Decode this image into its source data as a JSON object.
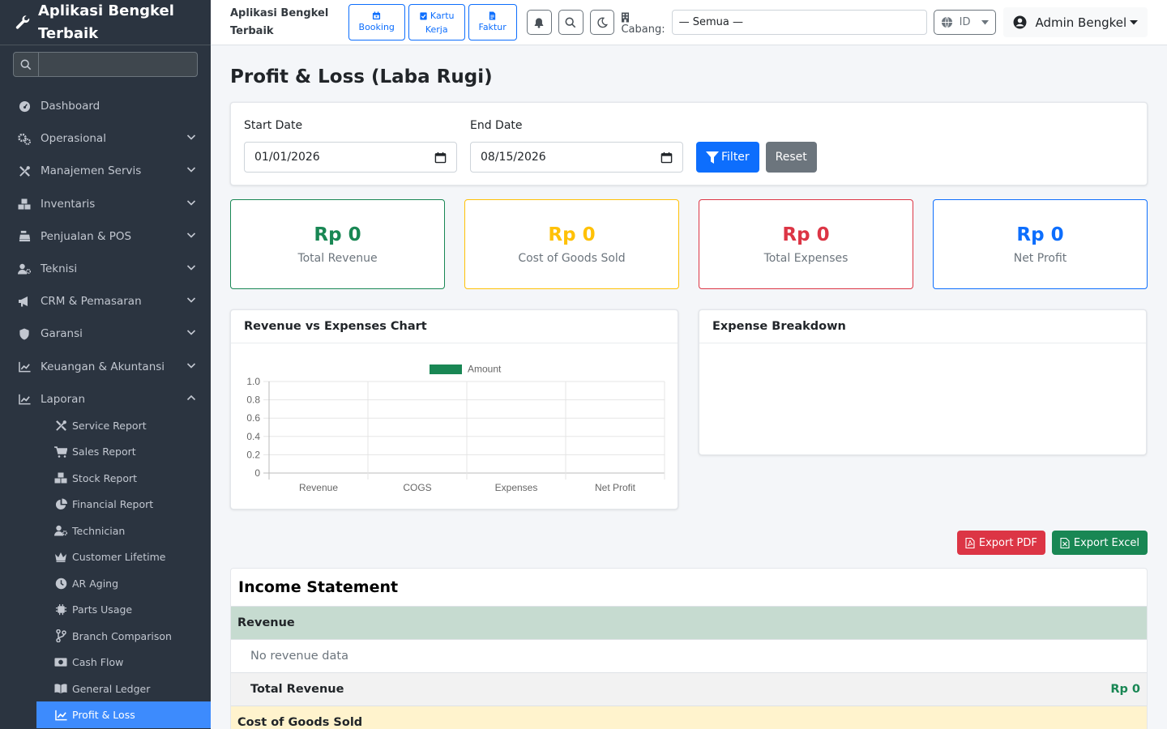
{
  "app": {
    "brand": "Aplikasi Bengkel Terbaik",
    "brand_line1": "Aplikasi Bengkel",
    "brand_line2": "Terbaik"
  },
  "sidebar": {
    "search_placeholder": "",
    "items": [
      {
        "label": "Dashboard",
        "icon": "gauge-icon",
        "has_children": false
      },
      {
        "label": "Operasional",
        "icon": "cogs-icon",
        "has_children": true
      },
      {
        "label": "Manajemen Servis",
        "icon": "tools-icon",
        "has_children": true
      },
      {
        "label": "Inventaris",
        "icon": "boxes-icon",
        "has_children": true
      },
      {
        "label": "Penjualan & POS",
        "icon": "cash-register-icon",
        "has_children": true
      },
      {
        "label": "Teknisi",
        "icon": "user-gear-icon",
        "has_children": true
      },
      {
        "label": "CRM & Pemasaran",
        "icon": "bullhorn-icon",
        "has_children": true
      },
      {
        "label": "Garansi",
        "icon": "shield-icon",
        "has_children": true
      },
      {
        "label": "Keuangan & Akuntansi",
        "icon": "chart-line-icon",
        "has_children": true
      },
      {
        "label": "Laporan",
        "icon": "chart-line-icon",
        "has_children": true,
        "expanded": true
      }
    ],
    "subitems": [
      {
        "label": "Service Report",
        "icon": "tools-icon"
      },
      {
        "label": "Sales Report",
        "icon": "cart-icon"
      },
      {
        "label": "Stock Report",
        "icon": "boxes-icon"
      },
      {
        "label": "Financial Report",
        "icon": "pie-chart-icon"
      },
      {
        "label": "Technician",
        "icon": "user-gear-icon"
      },
      {
        "label": "Customer Lifetime",
        "icon": "crown-icon"
      },
      {
        "label": "AR Aging",
        "icon": "clock-icon"
      },
      {
        "label": "Parts Usage",
        "icon": "microchip-icon"
      },
      {
        "label": "Branch Comparison",
        "icon": "code-branch-icon"
      },
      {
        "label": "Cash Flow",
        "icon": "money-bill-icon"
      },
      {
        "label": "General Ledger",
        "icon": "book-open-icon"
      },
      {
        "label": "Profit & Loss",
        "icon": "chart-line-icon",
        "active": true
      }
    ]
  },
  "topbar": {
    "brand_line1": "Aplikasi Bengkel",
    "brand_line2": "Terbaik",
    "quick_buttons": [
      {
        "label": "Booking",
        "icon": "calendar-icon"
      },
      {
        "label_line1": "Kartu",
        "label_line2": "Kerja",
        "icon": "clipboard-check-icon"
      },
      {
        "label": "Faktur",
        "icon": "file-invoice-icon"
      }
    ],
    "cabang_label": "Cabang:",
    "cabang_value": "— Semua —",
    "language": "ID",
    "user": "Admin Bengkel"
  },
  "page": {
    "title": "Profit & Loss (Laba Rugi)",
    "filter": {
      "start_label": "Start Date",
      "start_value": "01/01/2026",
      "end_label": "End Date",
      "end_value": "08/15/2026",
      "filter_label": "Filter",
      "reset_label": "Reset"
    },
    "stats": [
      {
        "amount": "Rp 0",
        "caption": "Total Revenue",
        "color": "#198754"
      },
      {
        "amount": "Rp 0",
        "caption": "Cost of Goods Sold",
        "color": "#ffc107"
      },
      {
        "amount": "Rp 0",
        "caption": "Total Expenses",
        "color": "#dc3545"
      },
      {
        "amount": "Rp 0",
        "caption": "Net Profit",
        "color": "#0d6efd"
      }
    ],
    "chart_title": "Revenue vs Expenses Chart",
    "expense_title": "Expense Breakdown",
    "export_pdf": "Export PDF",
    "export_excel": "Export Excel",
    "income": {
      "title": "Income Statement",
      "revenue_header": "Revenue",
      "no_revenue": "No revenue data",
      "total_revenue_label": "Total Revenue",
      "total_revenue_value": "Rp 0",
      "cogs_header": "Cost of Goods Sold"
    }
  },
  "colors": {
    "primary": "#0d6efd",
    "success": "#198754",
    "warning": "#ffc107",
    "danger": "#dc3545",
    "sidebar_bg": "#2b3440",
    "active_bg": "#3d8bfd"
  },
  "chart_data": {
    "type": "bar",
    "categories": [
      "Revenue",
      "COGS",
      "Expenses",
      "Net Profit"
    ],
    "series": [
      {
        "name": "Amount",
        "values": [
          0,
          0,
          0,
          0
        ],
        "color": "#198754"
      }
    ],
    "yticks": [
      "0",
      "0.2",
      "0.4",
      "0.6",
      "0.8",
      "1.0"
    ],
    "ylim": [
      0,
      1.0
    ],
    "legend": "top",
    "grid": true
  }
}
